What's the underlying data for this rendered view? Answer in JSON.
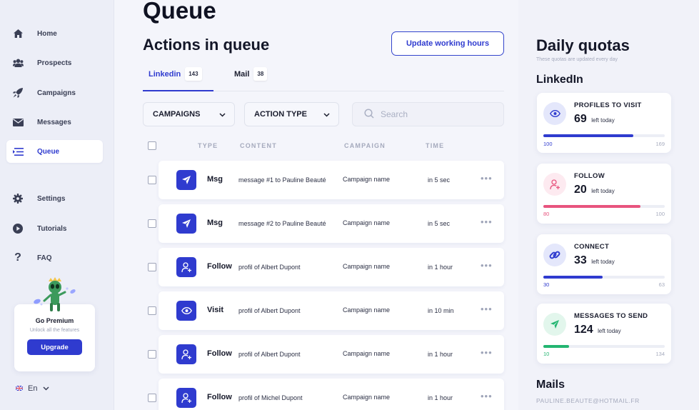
{
  "colors": {
    "accent": "#2f3bcf",
    "pink": "#e8547e",
    "green": "#23b571"
  },
  "sidebar": {
    "items": [
      {
        "label": "Home",
        "icon": "home-icon"
      },
      {
        "label": "Prospects",
        "icon": "users-icon"
      },
      {
        "label": "Campaigns",
        "icon": "rocket-icon"
      },
      {
        "label": "Messages",
        "icon": "envelope-icon"
      },
      {
        "label": "Queue",
        "icon": "queue-icon",
        "active": true
      },
      {
        "label": "Settings",
        "icon": "gear-icon"
      },
      {
        "label": "Tutorials",
        "icon": "play-icon"
      },
      {
        "label": "FAQ",
        "icon": "question-icon"
      }
    ],
    "premium": {
      "title": "Go Premium",
      "subtitle": "Unlock all the features",
      "button": "Upgrade"
    },
    "language": "En"
  },
  "main": {
    "page_title": "Queue",
    "section_title": "Actions in queue",
    "update_button": "Update working hours",
    "tabs": [
      {
        "label": "Linkedin",
        "count": "143",
        "active": true
      },
      {
        "label": "Mail",
        "count": "38"
      }
    ],
    "filters": {
      "campaigns": "CAMPAIGNS",
      "action_type": "ACTION TYPE",
      "search_placeholder": "Search"
    },
    "columns": {
      "type": "TYPE",
      "content": "CONTENT",
      "campaign": "CAMPAIGN",
      "time": "TIME"
    },
    "rows": [
      {
        "icon": "send-icon",
        "type": "Msg",
        "content": "message #1 to Pauline Beauté",
        "campaign": "Campaign name",
        "time": "in 5 sec"
      },
      {
        "icon": "send-icon",
        "type": "Msg",
        "content": "message #2 to Pauline Beauté",
        "campaign": "Campaign name",
        "time": "in 5 sec"
      },
      {
        "icon": "user-plus-icon",
        "type": "Follow",
        "content": "profil of Albert Dupont",
        "campaign": "Campaign name",
        "time": "in 1 hour"
      },
      {
        "icon": "eye-icon",
        "type": "Visit",
        "content": "profil of Albert Dupont",
        "campaign": "Campaign name",
        "time": "in 10 min"
      },
      {
        "icon": "user-plus-icon",
        "type": "Follow",
        "content": "profil of Albert Dupont",
        "campaign": "Campaign name",
        "time": "in 1 hour"
      },
      {
        "icon": "user-plus-icon",
        "type": "Follow",
        "content": "profil of Michel Dupont",
        "campaign": "Campaign name",
        "time": "in 1 hour"
      }
    ]
  },
  "quotas": {
    "title": "Daily quotas",
    "subtitle": "These quotas are updated every day",
    "linkedin_title": "LinkedIn",
    "cards": [
      {
        "label": "PROFILES TO VISIT",
        "value": "69",
        "suffix": "left today",
        "done": "100",
        "total": "169",
        "fraction": 0.74,
        "icon": "eye-icon"
      },
      {
        "label": "FOLLOW",
        "value": "20",
        "suffix": "left today",
        "done": "80",
        "total": "100",
        "fraction": 0.8,
        "icon": "user-plus-icon"
      },
      {
        "label": "CONNECT",
        "value": "33",
        "suffix": "left today",
        "done": "30",
        "total": "63",
        "fraction": 0.49,
        "icon": "link-icon"
      },
      {
        "label": "MESSAGES TO SEND",
        "value": "124",
        "suffix": "left today",
        "done": "10",
        "total": "134",
        "fraction": 0.21,
        "icon": "send-icon"
      }
    ],
    "mails_title": "Mails",
    "mail_address": "PAULINE.BEAUTE@HOTMAIL.FR"
  }
}
